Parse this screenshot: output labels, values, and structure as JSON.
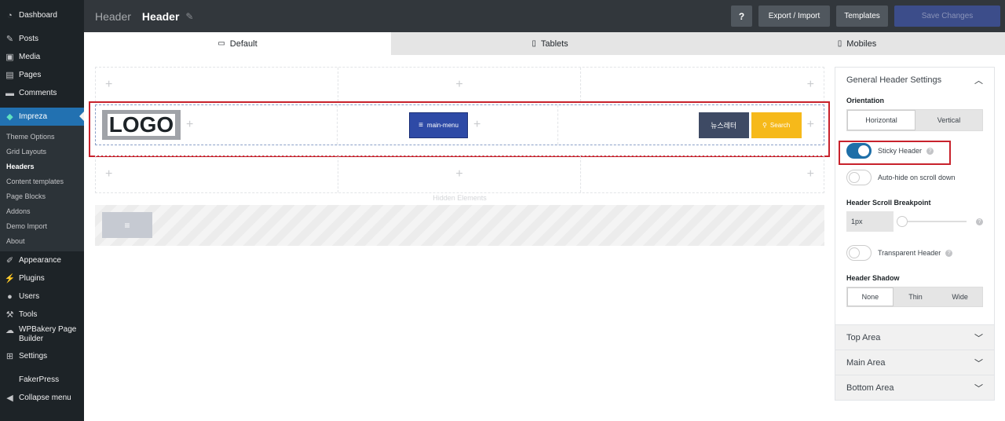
{
  "sidebar": {
    "items": [
      {
        "label": "Dashboard",
        "icon": "dashboard-icon"
      },
      {
        "label": "Posts",
        "icon": "pin-icon"
      },
      {
        "label": "Media",
        "icon": "media-icon"
      },
      {
        "label": "Pages",
        "icon": "pages-icon"
      },
      {
        "label": "Comments",
        "icon": "comments-icon"
      },
      {
        "label": "Impreza",
        "icon": "diamond-icon"
      }
    ],
    "submenu": [
      "Theme Options",
      "Grid Layouts",
      "Headers",
      "Content templates",
      "Page Blocks",
      "Addons",
      "Demo Import",
      "About"
    ],
    "items2": [
      {
        "label": "Appearance",
        "icon": "brush-icon"
      },
      {
        "label": "Plugins",
        "icon": "plug-icon"
      },
      {
        "label": "Users",
        "icon": "user-icon"
      },
      {
        "label": "Tools",
        "icon": "wrench-icon"
      },
      {
        "label": "WPBakery Page Builder",
        "icon": "cloud-icon"
      },
      {
        "label": "Settings",
        "icon": "settings-icon"
      },
      {
        "label": "FakerPress",
        "icon": "faker-icon"
      },
      {
        "label": "Collapse menu",
        "icon": "collapse-icon"
      }
    ]
  },
  "topbar": {
    "section_label": "Header",
    "title": "Header",
    "help_label": "?",
    "export_label": "Export / Import",
    "templates_label": "Templates",
    "save_label": "Save Changes"
  },
  "tabs": [
    {
      "label": "Default",
      "icon": "monitor-icon"
    },
    {
      "label": "Tablets",
      "icon": "tablet-icon"
    },
    {
      "label": "Mobiles",
      "icon": "mobile-icon"
    }
  ],
  "builder": {
    "plus": "+",
    "logo_text": "LOGO",
    "menu_label": "main-menu",
    "news_label": "뉴스레터",
    "search_label": "Search",
    "hidden_label": "Hidden Elements",
    "hidden_item": "≡"
  },
  "panel": {
    "general_title": "General Header Settings",
    "orientation_label": "Orientation",
    "orientation_options": [
      "Horizontal",
      "Vertical"
    ],
    "orientation_selected": "Horizontal",
    "sticky_label": "Sticky Header",
    "sticky_on": true,
    "autohide_label": "Auto-hide on scroll down",
    "autohide_on": false,
    "breakpoint_label": "Header Scroll Breakpoint",
    "breakpoint_value": "1px",
    "transparent_label": "Transparent Header",
    "transparent_on": false,
    "shadow_label": "Header Shadow",
    "shadow_options": [
      "None",
      "Thin",
      "Wide"
    ],
    "shadow_selected": "None",
    "top_area": "Top Area",
    "main_area": "Main Area",
    "bottom_area": "Bottom Area"
  }
}
